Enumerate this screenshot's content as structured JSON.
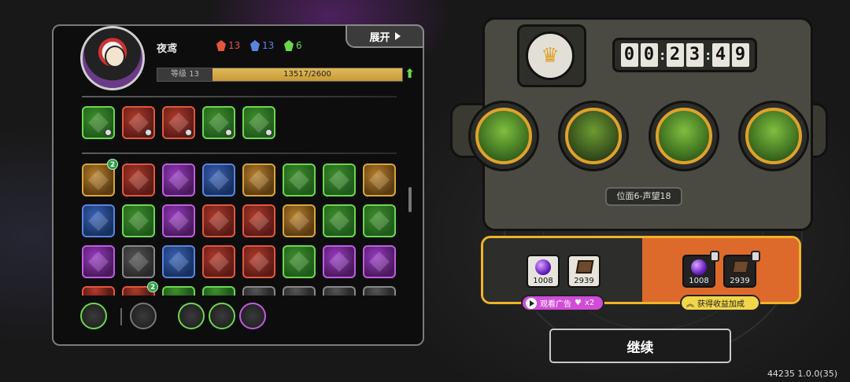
{
  "player": {
    "name": "夜鸢",
    "resources": [
      {
        "icon": "red-crystal-icon",
        "value": "13",
        "color": "#e2573b"
      },
      {
        "icon": "blue-crystal-icon",
        "value": "13",
        "color": "#5b84e0"
      },
      {
        "icon": "green-crystal-icon",
        "value": "6",
        "color": "#6bd84b"
      }
    ],
    "level_label": "等级 13",
    "xp_text": "13517/2600",
    "xp_fill": 1.0
  },
  "expand_label": "展开",
  "equipped_skills": [
    {
      "color": "g",
      "icon": "crossed-blades-icon"
    },
    {
      "color": "r",
      "icon": "claw-slash-icon"
    },
    {
      "color": "r",
      "icon": "skull-strike-icon"
    },
    {
      "color": "g",
      "icon": "fire-blast-icon"
    },
    {
      "color": "g",
      "icon": "leaf-spike-icon"
    }
  ],
  "skill_grid": [
    {
      "color": "y",
      "icon": "bomb-icon",
      "badge": "2"
    },
    {
      "color": "r",
      "icon": "spiral-icon"
    },
    {
      "color": "p",
      "icon": "flame-wall-icon"
    },
    {
      "color": "b",
      "icon": "shadow-hand-icon"
    },
    {
      "color": "y",
      "icon": "wind-cut-icon"
    },
    {
      "color": "g",
      "icon": "shatter-icon"
    },
    {
      "color": "g",
      "icon": "green-blade-icon"
    },
    {
      "color": "y",
      "icon": "gear-target-icon"
    },
    {
      "color": "b",
      "icon": "frost-dragon-icon"
    },
    {
      "color": "g",
      "icon": "heal-shield-icon"
    },
    {
      "color": "p",
      "icon": "spellbook-icon"
    },
    {
      "color": "r",
      "icon": "rank-badge-icon"
    },
    {
      "color": "r",
      "icon": "bullets-icon"
    },
    {
      "color": "y",
      "icon": "lightning-icon"
    },
    {
      "color": "g",
      "icon": "green-burst-icon"
    },
    {
      "color": "g",
      "icon": "red-beast-icon"
    },
    {
      "color": "p",
      "icon": "eye-orb-icon"
    },
    {
      "color": "w",
      "icon": "sun-gear-icon"
    },
    {
      "color": "b",
      "icon": "runner-icon"
    },
    {
      "color": "r",
      "icon": "triple-claw-icon"
    },
    {
      "color": "r",
      "icon": "red-slash-icon"
    },
    {
      "color": "g",
      "icon": "emerald-blade-icon"
    },
    {
      "color": "p",
      "icon": "crosshair-icon"
    },
    {
      "color": "p",
      "icon": "grab-hand-icon"
    }
  ],
  "partial_row": [
    {
      "color": "r",
      "icon": "partial-skill-icon"
    },
    {
      "color": "r",
      "icon": "partial-skill-icon",
      "badge": "2"
    },
    {
      "color": "g",
      "icon": "partial-skill-icon"
    },
    {
      "color": "g",
      "icon": "partial-skill-icon"
    },
    {
      "color": "w",
      "icon": "partial-skill-icon"
    },
    {
      "color": "w",
      "icon": "partial-skill-icon"
    },
    {
      "color": "w",
      "icon": "partial-skill-icon"
    },
    {
      "color": "w",
      "icon": "partial-skill-icon"
    }
  ],
  "bottom_items": [
    {
      "icon": "spiked-ring-icon",
      "color": "#6bd84b"
    },
    {
      "icon": "pistol-icon",
      "color": "#777777"
    },
    {
      "icon": "trio-orb-icon",
      "color": "#6bd84b"
    },
    {
      "icon": "silver-ring-icon",
      "color": "#6bd84b"
    },
    {
      "icon": "witch-hat-icon",
      "color": "#c05ce0"
    }
  ],
  "timer": [
    "0",
    "0",
    "2",
    "3",
    "4",
    "9"
  ],
  "heroes": [
    {
      "icon": "hooded-shadow-icon"
    },
    {
      "icon": "demon-mask-icon"
    },
    {
      "icon": "armored-beast-icon"
    },
    {
      "icon": "glasses-boy-icon"
    }
  ],
  "place_label": "位面6-声望18",
  "rewards": {
    "base": [
      {
        "icon": "purple-gem-icon",
        "value": "1008"
      },
      {
        "icon": "brown-book-icon",
        "value": "2939"
      }
    ],
    "bonus": [
      {
        "icon": "purple-gem-icon",
        "value": "1008"
      },
      {
        "icon": "brown-book-icon",
        "value": "2939"
      }
    ],
    "ad_label": "观看广告",
    "ad_multiplier": "x2",
    "bonus_label": "获得收益加成"
  },
  "continue_label": "继续",
  "version": "44235 1.0.0(35)"
}
